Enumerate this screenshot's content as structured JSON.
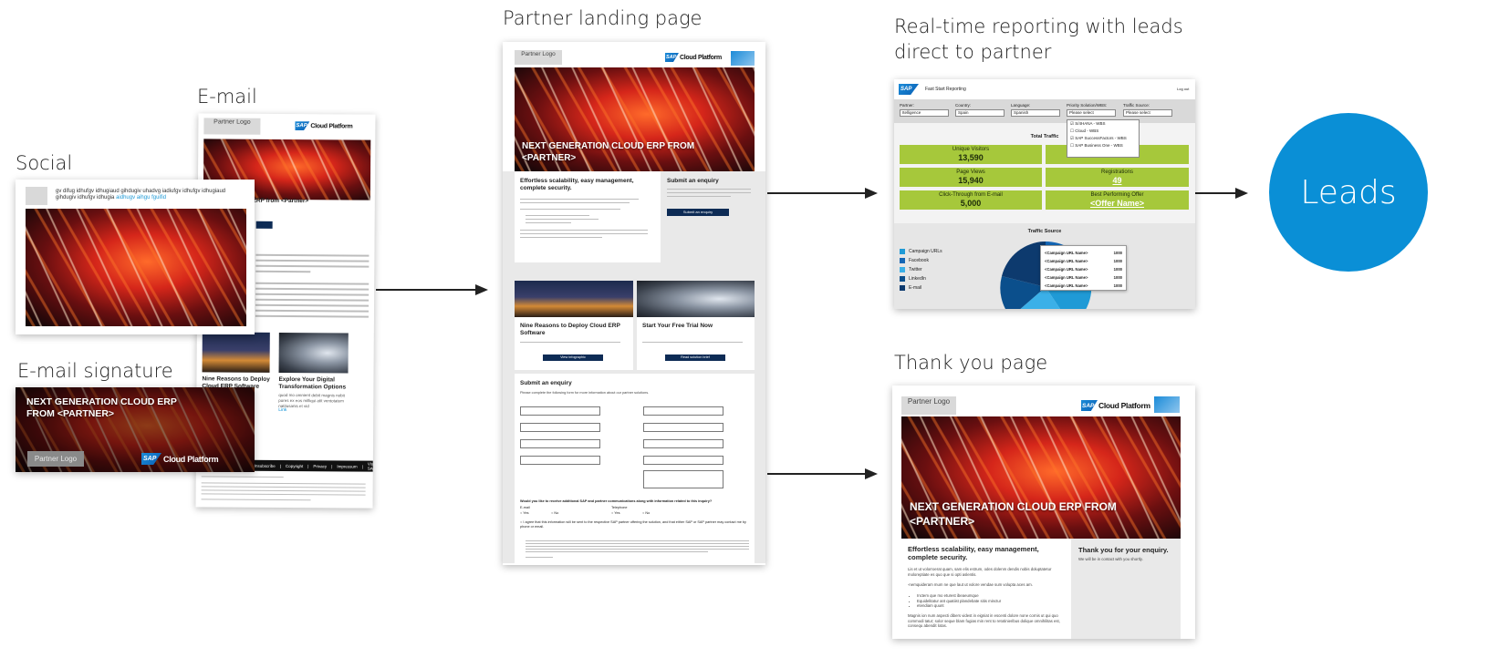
{
  "stages": {
    "social": "Social",
    "email": "E-mail",
    "email_signature": "E-mail signature",
    "landing": "Partner landing page",
    "reporting": "Real-time reporting with leads direct to partner",
    "thank_you": "Thank you page",
    "leads": "Leads"
  },
  "brand": {
    "partner_logo": "Partner Logo",
    "sap_badge": "SAP",
    "sap_product": "Cloud Platform",
    "accent": "#0a8fd6"
  },
  "social": {
    "post_text": "gv difug idhufgv idhugiaud gihdugiv uhadvg iadiufgv idhufgv idhugiaud gihdugiv idhufgv idhugia",
    "post_link": "aidhugv aihgu fguifid"
  },
  "email": {
    "headline_fragment": "ud ERP from <Partner>",
    "card1_title": "Nine Reasons to Deploy Cloud ERP Software",
    "card2_title": "Explore Your Digital Transformation Options",
    "card2_body": "quod mo omnient debit magnis nobit pores ex eos milliqui atit ventotatem natitusanis et vid",
    "card2_link": "Link",
    "footer_links": [
      "Unsubscribe",
      "Copyright",
      "Privacy",
      "Impressum",
      "Visit SAP.com"
    ]
  },
  "signature": {
    "headline": "NEXT GENERATION CLOUD ERP FROM <PARTNER>",
    "partner_logo": "Partner Logo"
  },
  "landing": {
    "hero_headline": "NEXT GENERATION CLOUD ERP FROM <PARTNER>",
    "intro_title": "Effortless scalability, easy management, complete security.",
    "enquiry_title": "Submit an enquiry",
    "enquiry_button": "Submit an enquiry",
    "card1_title": "Nine Reasons to Deploy Cloud ERP Software",
    "card1_button": "View infographic",
    "card2_title": "Start Your Free Trial Now",
    "card2_button": "Read solution brief",
    "form_title": "Submit an enquiry",
    "form_intro": "Please complete the following form for more information about our partner solutions.",
    "consent_question": "Would you like to receive additional SAP and partner communications along with information related to this inquiry?",
    "consent_email": "E-mail",
    "consent_phone": "Telephone",
    "yes": "Yes",
    "no": "No",
    "agree_text": "I agree that this information will be sent to the respective SAP partner offering the solution, and that either SAP or SAP partner may contact me by phone or email."
  },
  "reporting": {
    "header_title": "Fast Start Reporting",
    "logout": "Log out",
    "filters": [
      {
        "label": "Partner:",
        "value": "Itelligence"
      },
      {
        "label": "Country:",
        "value": "Spain"
      },
      {
        "label": "Language:",
        "value": "Spanish"
      },
      {
        "label": "Priority Solution/WBS:",
        "value": "Please select"
      },
      {
        "label": "Traffic Source:",
        "value": "Please select"
      }
    ],
    "dropdown_options": [
      "S/4HANA - WBS",
      "Cloud - WBS",
      "SAP SuccessFactors - WBS",
      "SAP Business One - WBS"
    ],
    "total_traffic_title": "Total Traffic",
    "metrics": [
      {
        "label": "Unique Visitors",
        "value": "13,590"
      },
      {
        "label": "",
        "value": "509"
      },
      {
        "label": "Page Views",
        "value": "15,940"
      },
      {
        "label": "Registrations",
        "value": "49"
      },
      {
        "label": "Click-Through from E-mail",
        "value": "5,000"
      },
      {
        "label": "Best Performing Offer",
        "value": "<Offer Name>"
      }
    ],
    "traffic_source_title": "Traffic Source",
    "legend": [
      {
        "name": "Campaign URLs",
        "color": "#1f9ad6"
      },
      {
        "name": "Facebook",
        "color": "#1466b5"
      },
      {
        "name": "Twitter",
        "color": "#3bb0e8"
      },
      {
        "name": "LinkedIn",
        "color": "#0b4f8c"
      },
      {
        "name": "E-mail",
        "color": "#0d3a6e"
      }
    ],
    "tooltip_rows": [
      {
        "name": "<Campaign URL Name>",
        "value": "1000"
      },
      {
        "name": "<Campaign URL Name>",
        "value": "1000"
      },
      {
        "name": "<Campaign URL Name>",
        "value": "1000"
      },
      {
        "name": "<Campaign URL Name>",
        "value": "1000"
      },
      {
        "name": "<Campaign URL Name>",
        "value": "1000"
      }
    ]
  },
  "thank_you": {
    "hero_headline": "NEXT GENERATION CLOUD ERP FROM <PARTNER>",
    "intro_title": "Effortless scalability, easy management, complete security.",
    "intro_body": "Lis et ut volorroerat quam, sam elis estrum, odes dolenm dendis nobis doluptatetur moloreptiate es quo que si opti aslentis.",
    "intro_body2": "-nemquideram mum ne que laut ut volore vendae sum volupta aces am.",
    "bullets": [
      "Inctem que mo eturest ibeaeumque",
      "Equidelitatur ant quatiist plandebate sitis minctur",
      "etendiam quunt"
    ],
    "intro_body3": "Magnis ion num aspecti dibers videst in eigniat in escenti dolore none cornis ut qui quo commodi tatur; solor seque blam fugias min rent to retotinieribus dolique omnihilitas est, consequ abendit lotas.",
    "thanks_title": "Thank you for your enquiry.",
    "thanks_body": "We will be in contact with you shortly."
  }
}
